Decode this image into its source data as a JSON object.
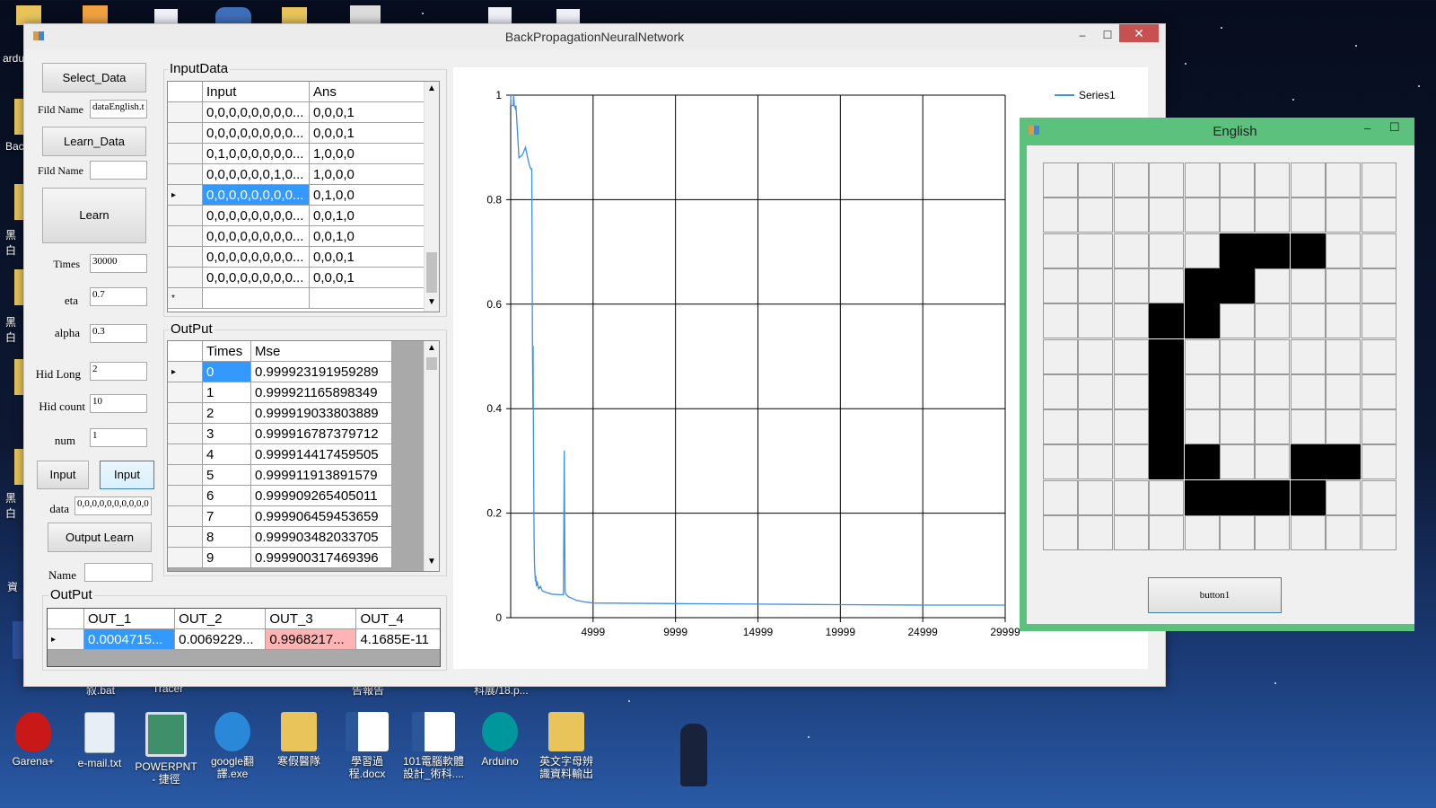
{
  "desktop": {
    "top_partial_labels": [
      "ardu",
      "Bac",
      "黑白",
      "黑白",
      "黑白",
      "資"
    ],
    "bottom_partial_labels": [
      "叙.bat",
      "Tracer",
      "告報告",
      "科展/18.p..."
    ],
    "bottom_icons": [
      {
        "label": "Garena+",
        "icon": "garena-icon",
        "color": "#c81818"
      },
      {
        "label": "e-mail.txt",
        "icon": "text-file-icon",
        "color": "#e8eef6"
      },
      {
        "label": "POWERPNT - 捷徑",
        "icon": "powerpoint-shortcut-icon",
        "color": "#3f8f6a"
      },
      {
        "label": "google翻譯.exe",
        "icon": "sync-icon",
        "color": "#2a88d8"
      },
      {
        "label": "寒假醫隊",
        "icon": "folder-icon",
        "color": "#e8c45a"
      },
      {
        "label": "學習過程.docx",
        "icon": "word-doc-icon",
        "color": "#2b579a"
      },
      {
        "label": "101電腦軟體設計_術科....",
        "icon": "word-doc-icon",
        "color": "#2b579a"
      },
      {
        "label": "Arduino",
        "icon": "arduino-icon",
        "color": "#00979c"
      },
      {
        "label": "英文字母辨識資料輸出",
        "icon": "folder-shortcut-icon",
        "color": "#e8c45a"
      }
    ]
  },
  "main_window": {
    "title": "BackPropagationNeuralNetwork",
    "controls": {
      "minimize": "–",
      "maximize": "☐",
      "close": "✕"
    },
    "left_panel": {
      "select_data": "Select_Data",
      "fild_name_label_1": "Fild Name",
      "fild_name_value_1": "dataEnglish.t",
      "learn_data": "Learn_Data",
      "fild_name_label_2": "Fild Name",
      "fild_name_value_2": "",
      "learn": "Learn",
      "times_label": "Times",
      "times_value": "30000",
      "eta_label": "eta",
      "eta_value": "0.7",
      "alpha_label": "alpha",
      "alpha_value": "0.3",
      "hid_long_label": "Hid Long",
      "hid_long_value": "2",
      "hid_count_label": "Hid count",
      "hid_count_value": "10",
      "num_label": "num",
      "num_value": "1",
      "input_btn_1": "Input",
      "input_btn_2": "Input",
      "data_label": "data",
      "data_value": "0,0,0,0,0,0,0,0,0,0",
      "output_learn": "Output Learn",
      "name_label": "Name",
      "name_value": ""
    },
    "input_data": {
      "title": "InputData",
      "headers": [
        "Input",
        "Ans"
      ],
      "rows": [
        [
          "0,0,0,0,0,0,0,0...",
          "0,0,0,1"
        ],
        [
          "0,0,0,0,0,0,0,0...",
          "0,0,0,1"
        ],
        [
          "0,1,0,0,0,0,0,0...",
          "1,0,0,0"
        ],
        [
          "0,0,0,0,0,0,1,0...",
          "1,0,0,0"
        ],
        [
          "0,0,0,0,0,0,0,0...",
          "0,1,0,0"
        ],
        [
          "0,0,0,0,0,0,0,0...",
          "0,0,1,0"
        ],
        [
          "0,0,0,0,0,0,0,0...",
          "0,0,1,0"
        ],
        [
          "0,0,0,0,0,0,0,0...",
          "0,0,0,1"
        ],
        [
          "0,0,0,0,0,0,0,0...",
          "0,0,0,1"
        ]
      ],
      "new_row_marker": "*",
      "current_marker": "▸"
    },
    "output_mse": {
      "title": "OutPut",
      "headers": [
        "Times",
        "Mse"
      ],
      "rows": [
        [
          "0",
          "0.999923191959289"
        ],
        [
          "1",
          "0.999921165898349"
        ],
        [
          "2",
          "0.999919033803889"
        ],
        [
          "3",
          "0.999916787379712"
        ],
        [
          "4",
          "0.999914417459505"
        ],
        [
          "5",
          "0.999911913891579"
        ],
        [
          "6",
          "0.999909265405011"
        ],
        [
          "7",
          "0.999906459453659"
        ],
        [
          "8",
          "0.999903482033705"
        ],
        [
          "9",
          "0.999900317469396"
        ]
      ]
    },
    "output_result": {
      "title": "OutPut",
      "headers": [
        "OUT_1",
        "OUT_2",
        "OUT_3",
        "OUT_4"
      ],
      "values": [
        "0.0004715...",
        "0.0069229...",
        "0.9968217...",
        "4.1685E-11"
      ]
    }
  },
  "chart_data": {
    "type": "line",
    "legend": [
      "Series1"
    ],
    "legend_position": "top-right",
    "series_color": "#3d8fe8",
    "xlim": [
      0,
      29999
    ],
    "ylim": [
      0,
      1
    ],
    "x_ticks": [
      "4999",
      "9999",
      "14999",
      "19999",
      "24999",
      "29999"
    ],
    "y_ticks": [
      "0",
      "0.2",
      "0.4",
      "0.6",
      "0.8",
      "1"
    ],
    "grid": true,
    "series": [
      {
        "name": "Series1",
        "x": [
          0,
          20,
          150,
          180,
          220,
          280,
          320,
          500,
          700,
          900,
          1100,
          1200,
          1250,
          1280,
          1300,
          1320,
          1350,
          1360,
          1380,
          1400,
          1420,
          1450,
          1480,
          1500,
          1520,
          1560,
          1600,
          1700,
          1800,
          1900,
          2000,
          2200,
          2500,
          3000,
          3200,
          3250,
          3300,
          3350,
          3500,
          4000,
          4500,
          5000,
          10000,
          15000,
          20000,
          25000,
          29999
        ],
        "y": [
          1.0,
          0.98,
          0.98,
          1.0,
          0.98,
          0.975,
          0.98,
          0.88,
          0.885,
          0.9,
          0.87,
          0.86,
          0.858,
          0.86,
          0.7,
          0.55,
          0.4,
          0.52,
          0.38,
          0.25,
          0.15,
          0.1,
          0.08,
          0.07,
          0.08,
          0.06,
          0.07,
          0.055,
          0.06,
          0.052,
          0.05,
          0.048,
          0.045,
          0.044,
          0.044,
          0.32,
          0.05,
          0.045,
          0.04,
          0.033,
          0.03,
          0.028,
          0.027,
          0.026,
          0.025,
          0.024,
          0.024
        ]
      }
    ]
  },
  "english_window": {
    "title": "English",
    "controls": {
      "minimize": "–",
      "maximize": "☐"
    },
    "button_label": "button1",
    "grid_rows": [
      [
        0,
        0,
        0,
        0,
        0,
        0,
        0,
        0,
        0,
        0
      ],
      [
        0,
        0,
        0,
        0,
        0,
        0,
        0,
        0,
        0,
        0
      ],
      [
        0,
        0,
        0,
        0,
        0,
        1,
        1,
        1,
        0,
        0
      ],
      [
        0,
        0,
        0,
        0,
        1,
        1,
        0,
        0,
        0,
        0
      ],
      [
        0,
        0,
        0,
        1,
        1,
        0,
        0,
        0,
        0,
        0
      ],
      [
        0,
        0,
        0,
        1,
        0,
        0,
        0,
        0,
        0,
        0
      ],
      [
        0,
        0,
        0,
        1,
        0,
        0,
        0,
        0,
        0,
        0
      ],
      [
        0,
        0,
        0,
        1,
        0,
        0,
        0,
        0,
        0,
        0
      ],
      [
        0,
        0,
        0,
        1,
        1,
        0,
        0,
        1,
        1,
        0
      ],
      [
        0,
        0,
        0,
        0,
        1,
        1,
        1,
        1,
        0,
        0
      ],
      [
        0,
        0,
        0,
        0,
        0,
        0,
        0,
        0,
        0,
        0
      ]
    ]
  }
}
